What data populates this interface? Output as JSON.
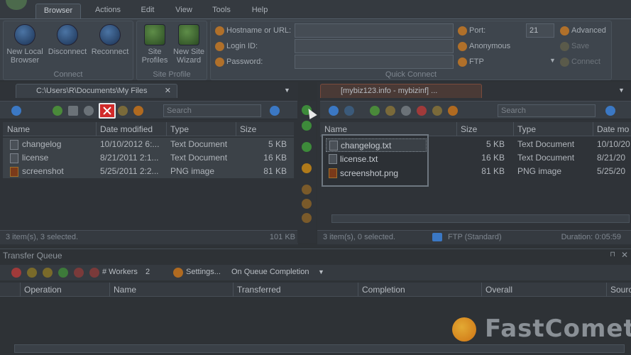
{
  "ribbon": {
    "tabs": [
      "Browser",
      "Actions",
      "Edit",
      "View",
      "Tools",
      "Help"
    ],
    "connect_group": {
      "label": "Connect",
      "buttons": [
        "New Local Browser",
        "Disconnect",
        "Reconnect"
      ]
    },
    "site_profile_group": {
      "label": "Site Profile",
      "buttons": [
        "Site Profiles",
        "New Site Wizard"
      ]
    },
    "quick_connect": {
      "label": "Quick Connect",
      "hostname_label": "Hostname or URL:",
      "login_label": "Login ID:",
      "password_label": "Password:",
      "port_label": "Port:",
      "port_value": "21",
      "anonymous_label": "Anonymous",
      "protocol_value": "FTP",
      "advanced_label": "Advanced",
      "save_label": "Save",
      "connect_label": "Connect"
    }
  },
  "local": {
    "tab_title": "C:\\Users\\R\\Documents\\My Files",
    "search_placeholder": "Search",
    "columns": [
      "Name",
      "Date modified",
      "Type",
      "Size"
    ],
    "rows": [
      {
        "name": "changelog",
        "date": "10/10/2012 6:...",
        "type": "Text Document",
        "size": "5 KB"
      },
      {
        "name": "license",
        "date": "8/21/2011 2:1...",
        "type": "Text Document",
        "size": "16 KB"
      },
      {
        "name": "screenshot",
        "date": "5/25/2011 2:2...",
        "type": "PNG image",
        "size": "81 KB"
      }
    ],
    "status_left": "3 item(s), 3 selected.",
    "status_right": "101 KB"
  },
  "remote": {
    "tab_title": "[mybiz123.info - mybizinf] ...",
    "search_placeholder": "Search",
    "columns": [
      "Name",
      "Size",
      "Type",
      "Date mo"
    ],
    "rows": [
      {
        "name": "changelog.txt",
        "size": "5 KB",
        "type": "Text Document",
        "date": "10/10/20"
      },
      {
        "name": "license.txt",
        "size": "16 KB",
        "type": "Text Document",
        "date": "8/21/20"
      },
      {
        "name": "screenshot.png",
        "size": "81 KB",
        "type": "PNG image",
        "date": "5/25/20"
      }
    ],
    "status_left": "3 item(s), 0 selected.",
    "status_mid": "FTP (Standard)",
    "status_right": "Duration: 0:05:59"
  },
  "transfer_queue": {
    "title": "Transfer Queue",
    "workers_label": "# Workers",
    "workers_value": "2",
    "settings_label": "Settings...",
    "completion_label": "On Queue Completion",
    "columns": [
      "Operation",
      "Name",
      "Transferred",
      "Completion",
      "Overall",
      "Sourc"
    ]
  },
  "brand": {
    "text": "FastComet"
  }
}
